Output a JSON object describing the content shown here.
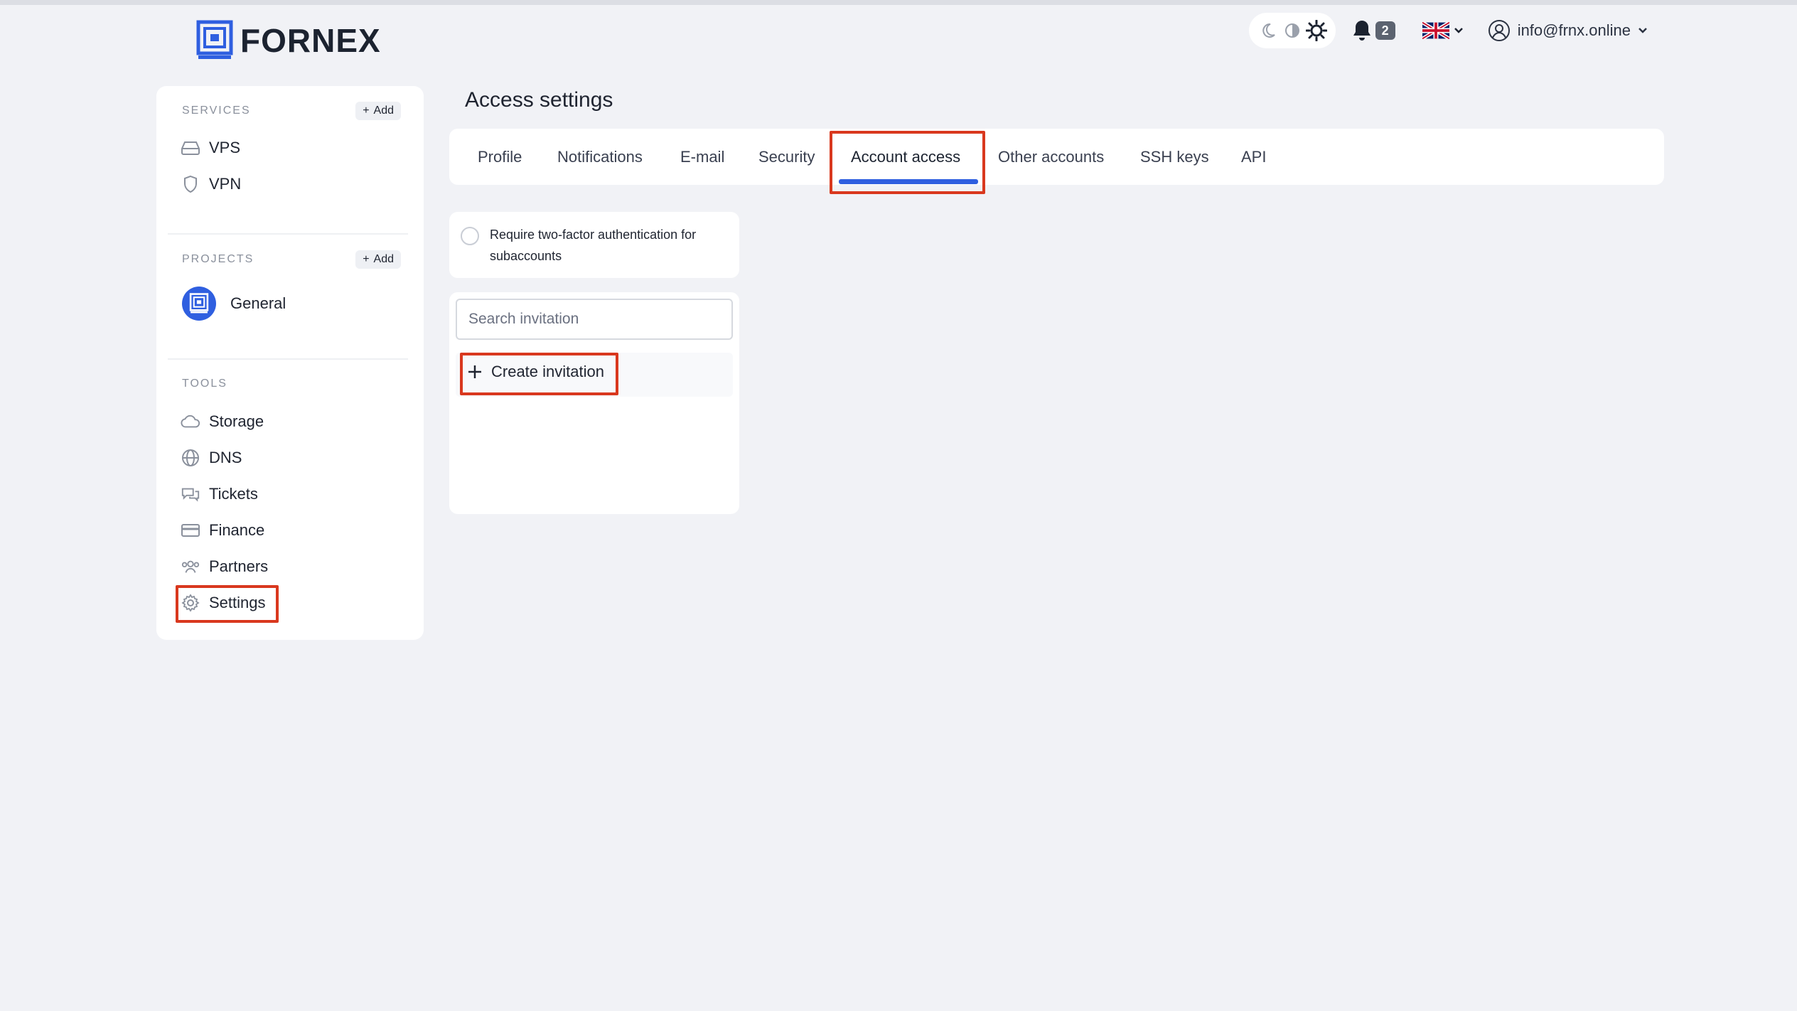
{
  "brand": {
    "name": "FORNEX"
  },
  "header": {
    "notifications_count": "2",
    "user_email": "info@frnx.online"
  },
  "sidebar": {
    "services": {
      "title": "SERVICES",
      "add_label": "Add",
      "items": [
        {
          "label": "VPS",
          "icon": "server-icon"
        },
        {
          "label": "VPN",
          "icon": "shield-icon"
        }
      ]
    },
    "projects": {
      "title": "PROJECTS",
      "add_label": "Add",
      "items": [
        {
          "label": "General",
          "icon": "project-logo-icon"
        }
      ]
    },
    "tools": {
      "title": "TOOLS",
      "items": [
        {
          "label": "Storage",
          "icon": "cloud-icon"
        },
        {
          "label": "DNS",
          "icon": "globe-icon"
        },
        {
          "label": "Tickets",
          "icon": "chat-icon"
        },
        {
          "label": "Finance",
          "icon": "card-icon"
        },
        {
          "label": "Partners",
          "icon": "users-icon"
        },
        {
          "label": "Settings",
          "icon": "gear-icon"
        }
      ]
    }
  },
  "main": {
    "title": "Access settings",
    "tabs": [
      {
        "label": "Profile"
      },
      {
        "label": "Notifications"
      },
      {
        "label": "E-mail"
      },
      {
        "label": "Security"
      },
      {
        "label": "Account access"
      },
      {
        "label": "Other accounts"
      },
      {
        "label": "SSH keys"
      },
      {
        "label": "API"
      }
    ],
    "active_tab": "Account access",
    "two_factor": {
      "label": "Require two-factor authentication for subaccounts",
      "checked": false
    },
    "search": {
      "placeholder": "Search invitation",
      "value": ""
    },
    "create_label": "Create invitation"
  },
  "colors": {
    "accent": "#2f5fe0",
    "highlight": "#d9381e",
    "background": "#f1f2f6"
  }
}
